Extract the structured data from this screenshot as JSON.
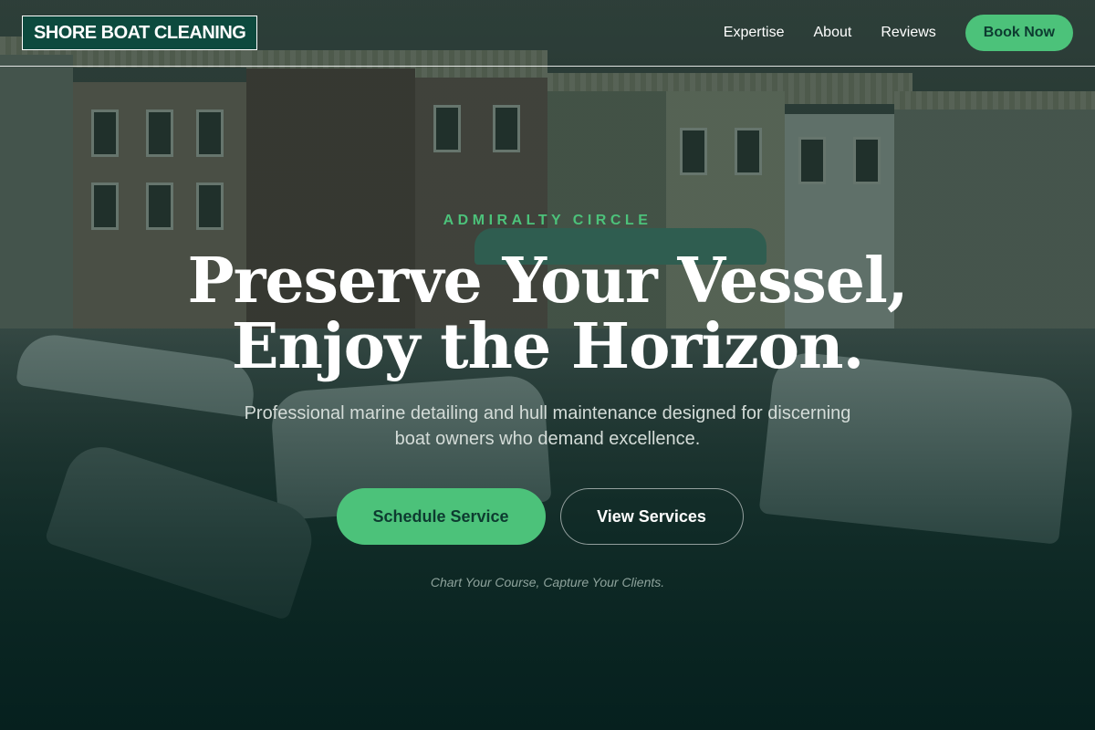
{
  "brand": {
    "logo_text": "SHORE BOAT CLEANING"
  },
  "nav": {
    "items": [
      {
        "label": "Expertise"
      },
      {
        "label": "About"
      },
      {
        "label": "Reviews"
      }
    ],
    "cta_label": "Book Now"
  },
  "hero": {
    "eyebrow": "ADMIRALTY CIRCLE",
    "headline_line1": "Preserve Your Vessel,",
    "headline_line2": "Enjoy the Horizon.",
    "subtitle": "Professional marine detailing and hull maintenance designed for discerning boat owners who demand excellence.",
    "primary_cta": "Schedule Service",
    "secondary_cta": "View Services",
    "tagline": "Chart Your Course, Capture Your Clients."
  },
  "colors": {
    "accent": "#4cc27a",
    "logo_bg": "#0d4a3e",
    "overlay": "#082822"
  }
}
